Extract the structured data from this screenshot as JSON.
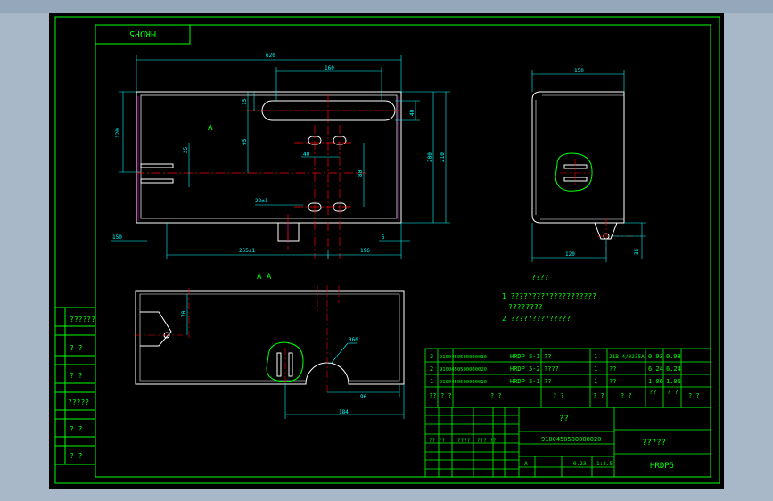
{
  "drawing": {
    "title_flipped": "HRDP5",
    "view_label_a": "A",
    "view_label_aa": "A  A",
    "notes_title": "????",
    "notes": [
      "1  ????????????????????",
      "????????",
      "2  ??????????????"
    ]
  },
  "dimensions": {
    "top_overall": "620",
    "top_inner": "160",
    "left_h": "120",
    "r_1": "200",
    "r_2": "210",
    "r_3": "40",
    "d_15": "15",
    "d_95": "95",
    "d_40": "40",
    "d_80": "80",
    "d_25": "25",
    "d_255": "255±1",
    "d_196": "196",
    "d_150": "150",
    "d_5": "5",
    "d_22": "22±1",
    "side_top": "150",
    "side_bot": "120",
    "side_r": "35",
    "sec_70": "70",
    "sec_r60": "R60",
    "sec_96": "96",
    "sec_184": "184"
  },
  "left_strip": [
    "??????",
    "? ?",
    "? ?",
    "?????",
    "? ?",
    "? ?"
  ],
  "bom_rows": [
    {
      "no": "3",
      "code": "9100450500000030",
      "name": "HRDP 5-1",
      "desc": "??",
      "qty": "1",
      "mat": "21B-4/0235A",
      "w1": "0.93",
      "w2": "0.93"
    },
    {
      "no": "2",
      "code": "9100450500000020",
      "name": "HRDP 5-2",
      "desc": "????",
      "qty": "1",
      "mat": "??",
      "w1": "6.24",
      "w2": "6.24"
    },
    {
      "no": "1",
      "code": "9100450500000010",
      "name": "HRDP 5-1",
      "desc": "??",
      "qty": "1",
      "mat": "??",
      "w1": "1.06",
      "w2": "1.06"
    }
  ],
  "bom_header": [
    "??",
    "? ?",
    "? ?",
    "? ?",
    "? ?",
    "? ?",
    "??",
    "? ?",
    "? ?"
  ],
  "title_block": {
    "name": "??",
    "code": "9100450500000020",
    "company": "?????",
    "drawing_no": "HRDP5",
    "scale": "0.23",
    "stage": "A",
    "ratio": "1:2.5",
    "sign_row": [
      "?? ??",
      "????",
      "??? ??"
    ]
  },
  "colors": {
    "bg": "#000000",
    "frame": "#00ff00",
    "dim": "#00ffff",
    "center": "#ff0000",
    "part": "#ffffff"
  }
}
